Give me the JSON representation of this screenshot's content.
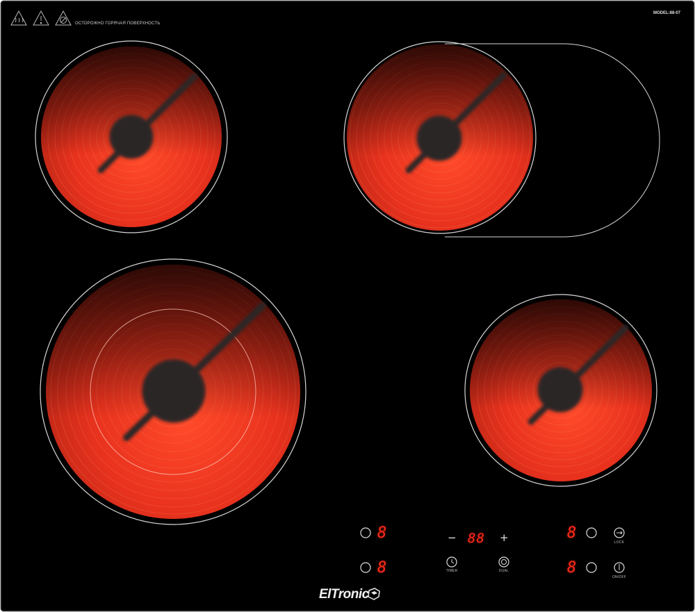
{
  "warning": {
    "text": "ОСТОРОЖНО ГОРЯЧАЯ ПОВЕРХНОСТЬ"
  },
  "model": {
    "text": "MODEL:88-07"
  },
  "brand": {
    "name": "ElTronic"
  },
  "controls": {
    "display_top_left": "8",
    "display_bottom_left": "8",
    "display_top_right": "8",
    "display_bottom_right": "8",
    "timer_display": "88",
    "minus": "−",
    "plus": "+",
    "timer_label": "TIMER",
    "dual_label": "DUAL",
    "lock_label": "LOCK",
    "onoff_label": "ON/OFF"
  },
  "colors": {
    "glass": "#000000",
    "burner_hot": "#e8321e",
    "burner_dark": "#6a1a10",
    "display_red": "#ff2a1a",
    "outline": "#d8d8d8"
  }
}
